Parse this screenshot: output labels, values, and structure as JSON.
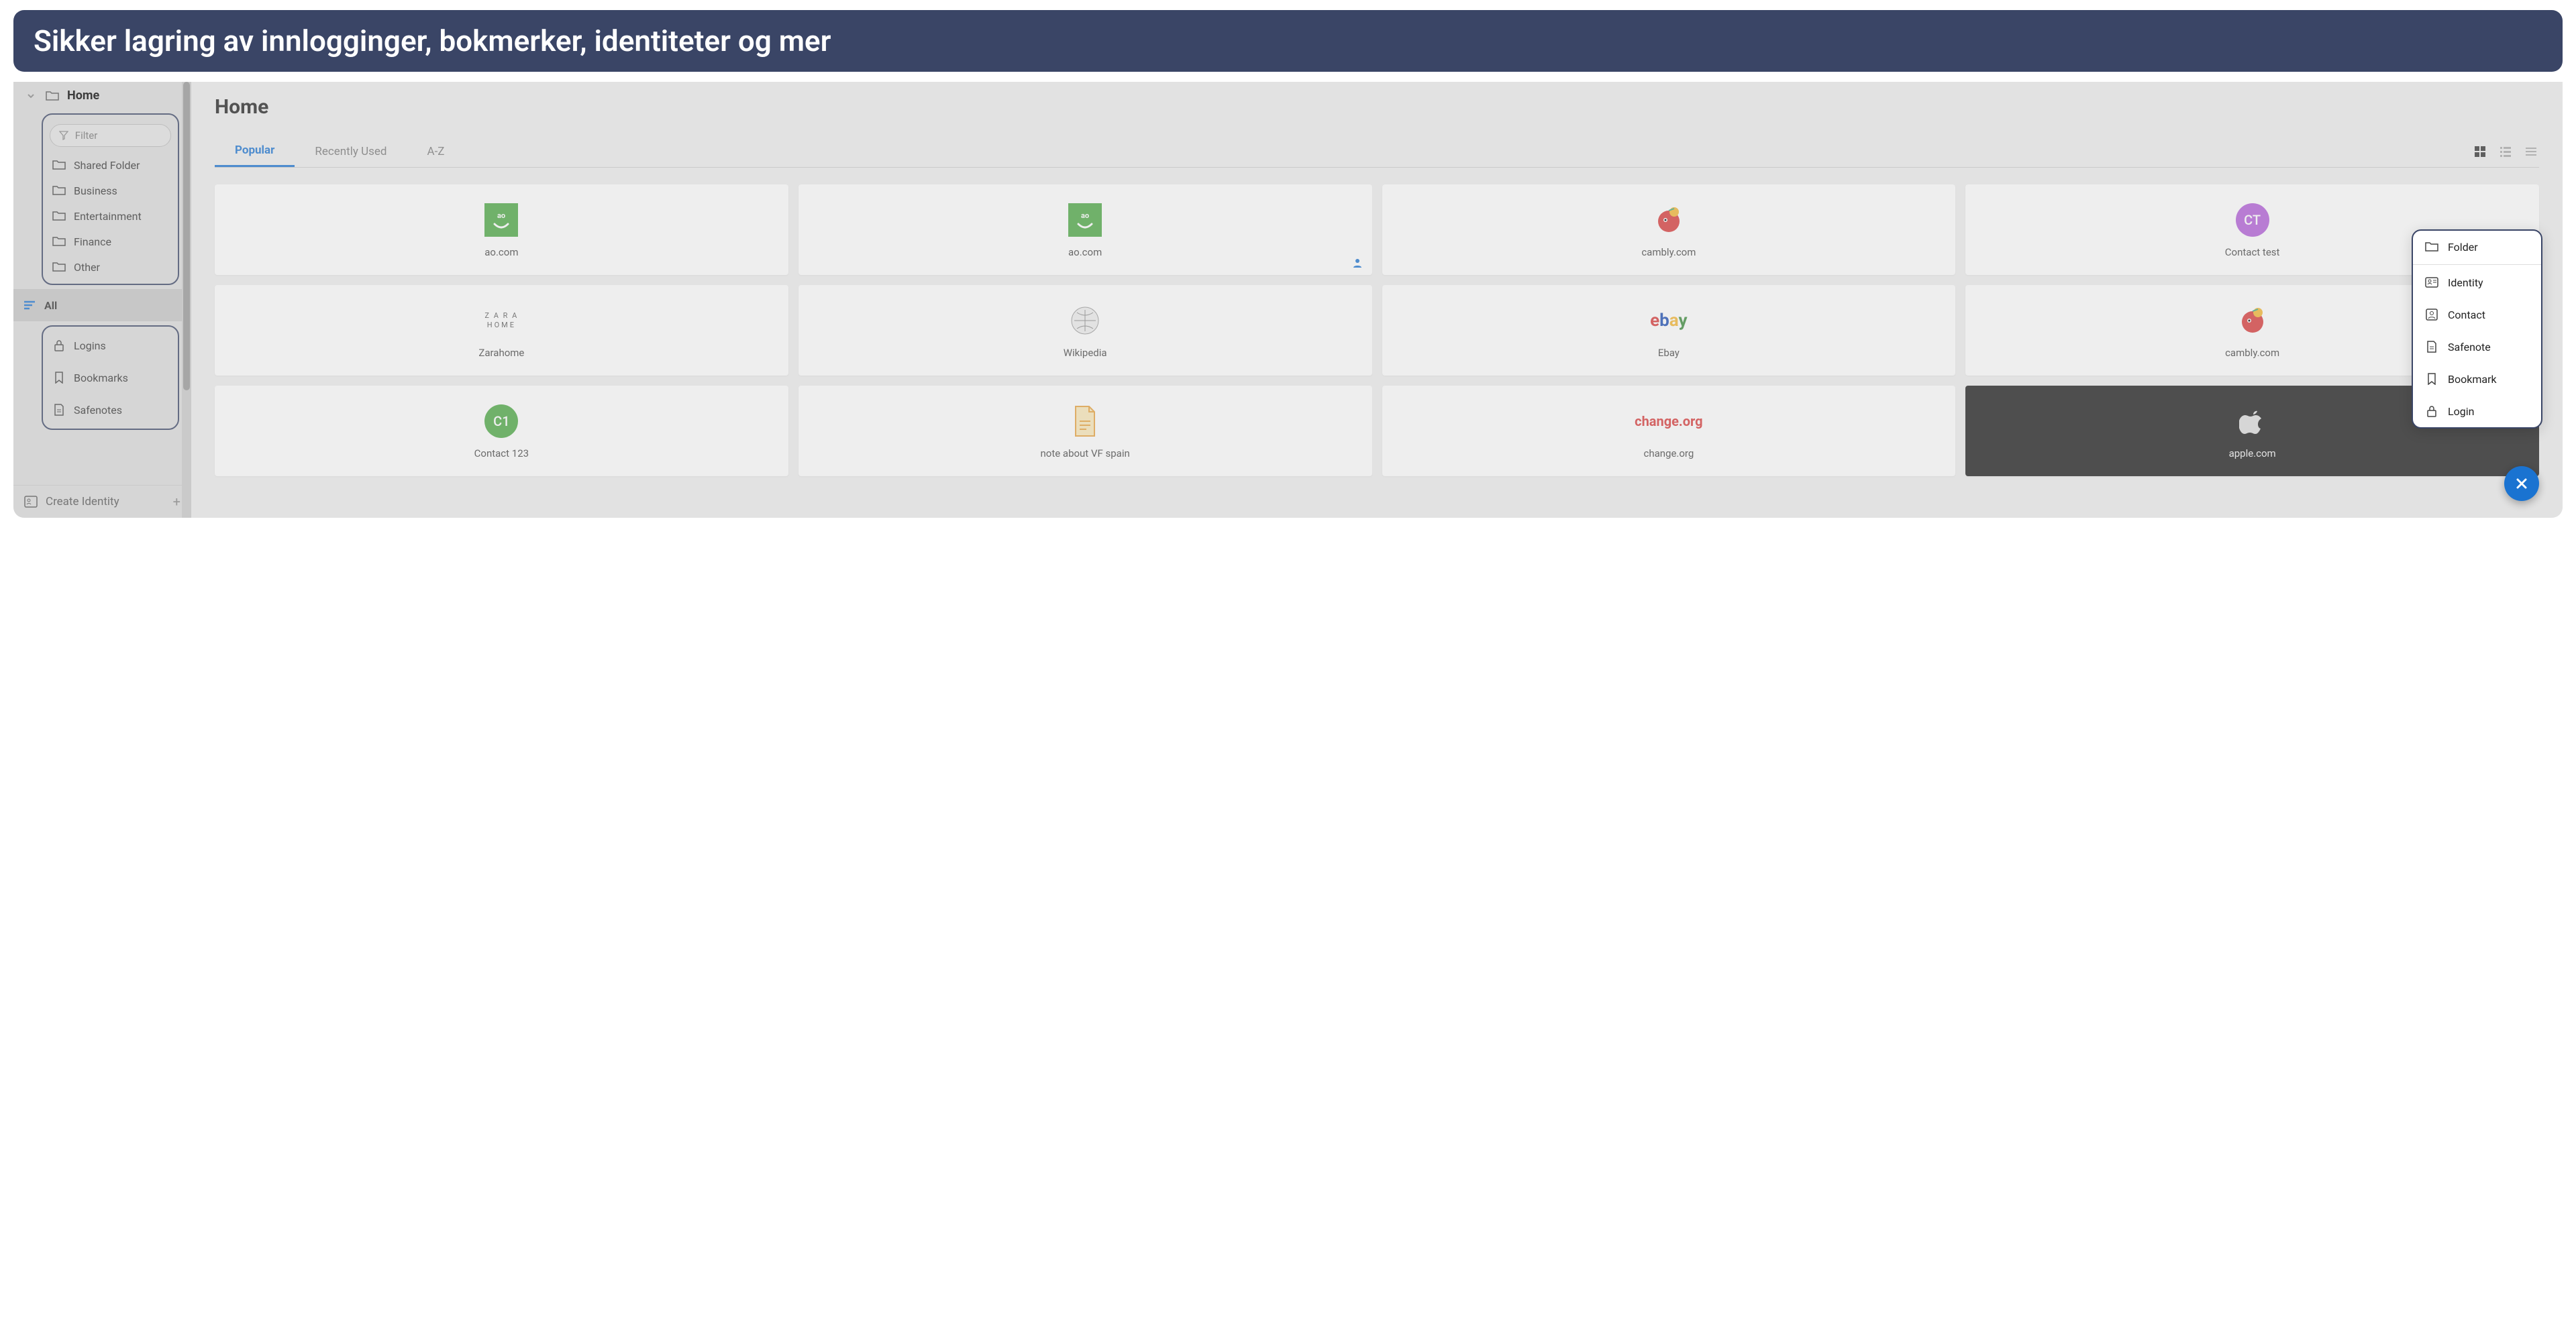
{
  "banner": "Sikker lagring av innlogginger, bokmerker, identiteter og mer",
  "sidebar": {
    "home": "Home",
    "filter_placeholder": "Filter",
    "folders": [
      "Shared Folder",
      "Business",
      "Entertainment",
      "Finance",
      "Other"
    ],
    "categories": [
      {
        "label": "All",
        "icon": "lines",
        "active": true
      },
      {
        "label": "Logins",
        "icon": "lock"
      },
      {
        "label": "Bookmarks",
        "icon": "bookmark"
      },
      {
        "label": "Safenotes",
        "icon": "note"
      }
    ],
    "create_identity": "Create Identity"
  },
  "main": {
    "title": "Home",
    "tabs": [
      "Popular",
      "Recently Used",
      "A-Z"
    ],
    "active_tab": 0,
    "items": [
      {
        "label": "ao.com",
        "type": "ao"
      },
      {
        "label": "ao.com",
        "type": "ao",
        "shared": true
      },
      {
        "label": "cambly.com",
        "type": "cambly"
      },
      {
        "label": "Contact test",
        "type": "circle",
        "initials": "CT",
        "color": "#b25cd9"
      },
      {
        "label": "Zarahome",
        "type": "zara"
      },
      {
        "label": "Wikipedia",
        "type": "wiki"
      },
      {
        "label": "Ebay",
        "type": "ebay"
      },
      {
        "label": "cambly.com",
        "type": "cambly"
      },
      {
        "label": "Contact 123",
        "type": "circle",
        "initials": "C1",
        "color": "#4ba843"
      },
      {
        "label": "note about VF spain",
        "type": "file"
      },
      {
        "label": "change.org",
        "type": "change"
      },
      {
        "label": "apple.com",
        "type": "apple",
        "dark": true
      }
    ]
  },
  "popup": [
    {
      "label": "Folder",
      "icon": "folder"
    },
    {
      "label": "Identity",
      "icon": "identity",
      "sep": true
    },
    {
      "label": "Contact",
      "icon": "contact"
    },
    {
      "label": "Safenote",
      "icon": "note"
    },
    {
      "label": "Bookmark",
      "icon": "bookmark"
    },
    {
      "label": "Login",
      "icon": "lock"
    }
  ]
}
